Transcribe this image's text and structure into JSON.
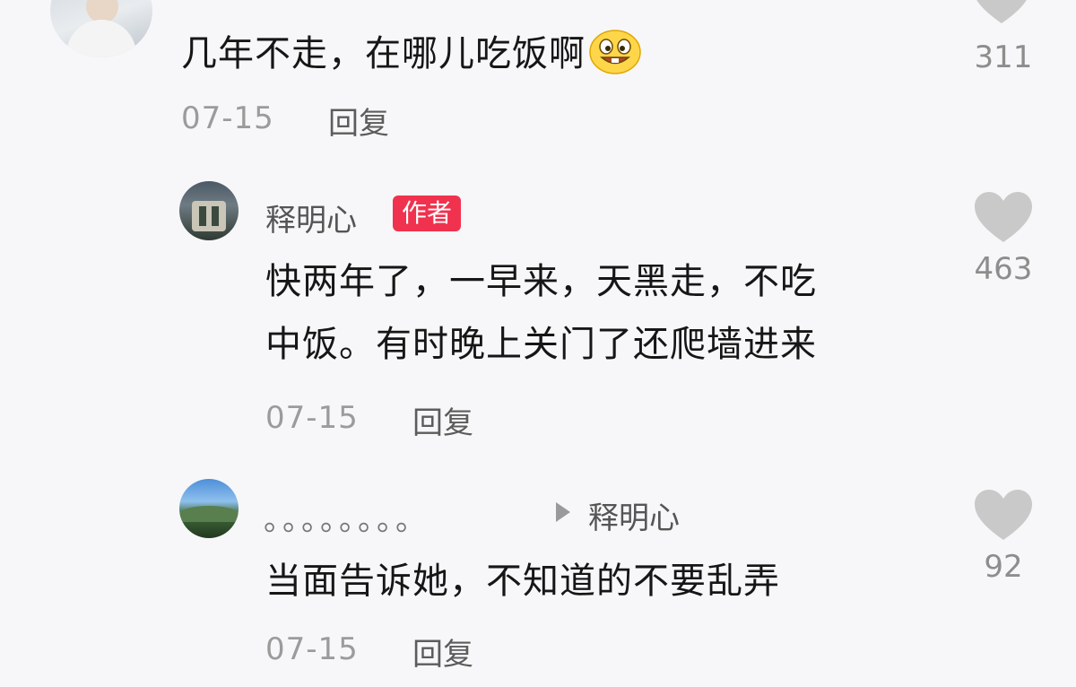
{
  "comments": [
    {
      "text": "几年不走，在哪儿吃饭啊",
      "date": "07-15",
      "reply_label": "回复",
      "likes": "311",
      "emoji": "grinning-face-icon"
    },
    {
      "username": "释明心",
      "badge": "作者",
      "text_line1": "快两年了，一早来，天黑走，不吃",
      "text_line2": "中饭。有时晚上关门了还爬墙进来",
      "date": "07-15",
      "reply_label": "回复",
      "likes": "463"
    },
    {
      "username": "。。。。。。。。",
      "reply_to": "释明心",
      "text": "当面告诉她，不知道的不要乱弄",
      "date": "07-15",
      "reply_label": "回复",
      "likes": "92"
    }
  ],
  "colors": {
    "background": "#f7f7f9",
    "badge": "#f0324e",
    "heart": "#c9c9c9"
  }
}
